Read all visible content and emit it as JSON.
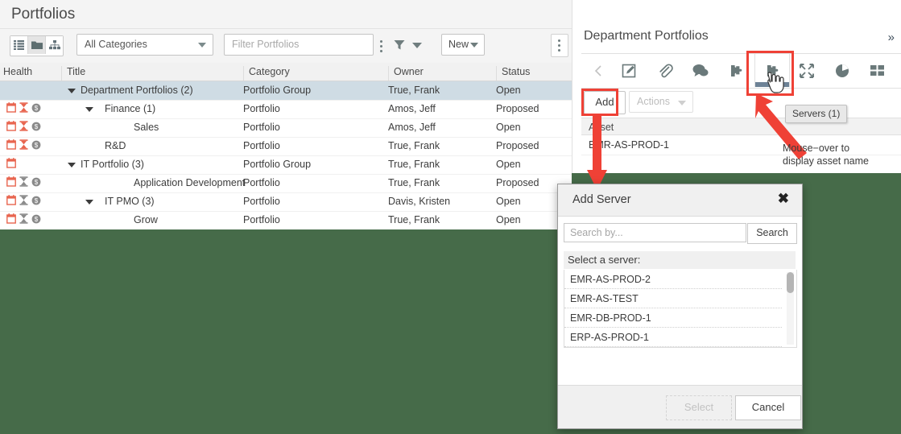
{
  "left": {
    "title": "Portfolios",
    "viewmodes": [
      {
        "name": "list-view",
        "active": false
      },
      {
        "name": "folder-view",
        "active": true
      },
      {
        "name": "hierarchy-view",
        "active": false
      }
    ],
    "category_select": "All Categories",
    "filter_placeholder": "Filter Portfolios",
    "new_button": "New",
    "columns": [
      "Health",
      "Title",
      "Category",
      "Owner",
      "Status"
    ],
    "rows": [
      {
        "health": [],
        "twisty": true,
        "indent": 1,
        "title": "Department Portfolios (2)",
        "category": "Portfolio Group",
        "owner": "True, Frank",
        "status": "Open",
        "selected": true
      },
      {
        "health": [
          "calendar-red",
          "hourglass-red",
          "dollar-grey"
        ],
        "twisty": true,
        "indent": 2,
        "title": "Finance (1)",
        "category": "Portfolio",
        "owner": "Amos, Jeff",
        "status": "Proposed",
        "selected": false
      },
      {
        "health": [
          "calendar-red",
          "hourglass-red",
          "dollar-grey"
        ],
        "twisty": false,
        "indent": 3,
        "title": "Sales",
        "category": "Portfolio",
        "owner": "Amos, Jeff",
        "status": "Open",
        "selected": false
      },
      {
        "health": [
          "calendar-red",
          "hourglass-red",
          "dollar-grey"
        ],
        "twisty": false,
        "indent": 2,
        "title": "R&D",
        "category": "Portfolio",
        "owner": "True, Frank",
        "status": "Proposed",
        "selected": false
      },
      {
        "health": [
          "calendar-red"
        ],
        "twisty": true,
        "indent": 1,
        "title": "IT Portfolio (3)",
        "category": "Portfolio Group",
        "owner": "True, Frank",
        "status": "Open",
        "selected": false
      },
      {
        "health": [
          "calendar-red",
          "hourglass-grey",
          "dollar-grey"
        ],
        "twisty": false,
        "indent": 3,
        "title": "Application Development",
        "category": "Portfolio",
        "owner": "True, Frank",
        "status": "Proposed",
        "selected": false
      },
      {
        "health": [
          "calendar-red",
          "hourglass-grey",
          "dollar-grey"
        ],
        "twisty": true,
        "indent": 2,
        "title": "IT PMO (3)",
        "category": "Portfolio",
        "owner": "Davis, Kristen",
        "status": "Open",
        "selected": false
      },
      {
        "health": [
          "calendar-red",
          "hourglass-grey",
          "dollar-grey"
        ],
        "twisty": false,
        "indent": 3,
        "title": "Grow",
        "category": "Portfolio",
        "owner": "True, Frank",
        "status": "Open",
        "selected": false
      }
    ]
  },
  "right": {
    "title": "Department Portfolios",
    "expand_glyph": "»",
    "toolbar_icons": [
      {
        "name": "prev-chevron-icon",
        "active": false
      },
      {
        "name": "edit-icon",
        "active": false
      },
      {
        "name": "attachment-icon",
        "active": false
      },
      {
        "name": "comments-icon",
        "active": false
      },
      {
        "name": "puzzle-icon",
        "active": false
      },
      {
        "name": "servers-puzzle-icon",
        "active": true
      },
      {
        "name": "expand-arrows-icon",
        "active": false
      },
      {
        "name": "pie-chart-icon",
        "active": false
      },
      {
        "name": "grid-icon",
        "active": false
      },
      {
        "name": "next-chevron-icon",
        "active": false
      }
    ],
    "add_button": "Add",
    "actions_button": "Actions",
    "asset_column": "Asset",
    "asset_rows": [
      "EMR-AS-PROD-1"
    ],
    "tooltip": "Servers (1)"
  },
  "annotations": {
    "mouseover_note": "Mouse−over to\ndisplay asset name",
    "mouseover_line1": "Mouse−over to",
    "mouseover_line2": "display asset name",
    "highlight_color": "#ef4136"
  },
  "modal": {
    "title": "Add Server",
    "close_glyph": "✖",
    "search_placeholder": "Search by...",
    "search_button": "Search",
    "list_label": "Select a server:",
    "servers": [
      "EMR-AS-PROD-2",
      "EMR-AS-TEST",
      "EMR-DB-PROD-1",
      "ERP-AS-PROD-1"
    ],
    "select_button": "Select",
    "cancel_button": "Cancel"
  },
  "colors": {
    "background_green": "#466b49",
    "selected_row": "#cfdce4",
    "active_tab_bar": "#6d8296",
    "health_red": "#e8654f",
    "health_grey": "#8a8a8a"
  }
}
